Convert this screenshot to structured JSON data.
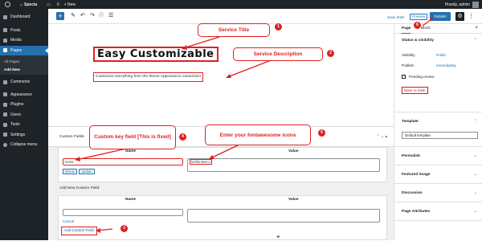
{
  "adminbar": {
    "site": "Specia",
    "comments_count": "0",
    "new_label": "+ New",
    "greeting": "Howdy, admin"
  },
  "sidebar": {
    "items_top": [
      {
        "label": "Dashboard",
        "icon": "dashboard-icon"
      },
      {
        "label": "Posts",
        "icon": "pin-icon"
      },
      {
        "label": "Media",
        "icon": "media-icon"
      },
      {
        "label": "Pages",
        "icon": "pages-icon"
      }
    ],
    "pages_sub": [
      "All Pages",
      "Add New"
    ],
    "items_bottom": [
      {
        "label": "Comments",
        "icon": "comment-icon"
      },
      {
        "label": "Appearance",
        "icon": "brush-icon"
      },
      {
        "label": "Plugins",
        "icon": "plugin-icon"
      },
      {
        "label": "Users",
        "icon": "user-icon"
      },
      {
        "label": "Tools",
        "icon": "wrench-icon"
      },
      {
        "label": "Settings",
        "icon": "settings-icon"
      },
      {
        "label": "Collapse menu",
        "icon": "collapse-icon"
      }
    ]
  },
  "toolbar": {
    "save_draft": "Save draft",
    "preview": "Preview",
    "publish": "Publish"
  },
  "editor": {
    "title": "Easy Customizable",
    "description": "Customize everything from the theme Appearance customizer"
  },
  "custom_fields": {
    "heading": "Custom Fields",
    "col_name": "Name",
    "col_value": "Value",
    "key": "icons",
    "value": "fa-file-text-o",
    "delete_label": "Delete",
    "update_label": "Update",
    "add_new_heading": "Add New Custom Field:",
    "cancel_label": "Cancel",
    "add_button": "Add Custom Field"
  },
  "callouts": [
    {
      "num": "1",
      "text": "Service Title"
    },
    {
      "num": "2",
      "text": "Service Description"
    },
    {
      "num": "3",
      "text": ""
    },
    {
      "num": "4",
      "text": "Custom key field [This is fixed]"
    },
    {
      "num": "5",
      "text": "Enter your fontawesome icons"
    },
    {
      "num": "6",
      "text": ""
    }
  ],
  "panel": {
    "tab_page": "Page",
    "tab_block": "Block",
    "status_heading": "Status & visibility",
    "visibility_label": "Visibility",
    "visibility_value": "Public",
    "publish_label": "Publish",
    "publish_value": "Immediately",
    "pending_label": "Pending review",
    "trash_label": "Move to trash",
    "template_heading": "Template",
    "template_value": "Default template",
    "permalink": "Permalink",
    "featured_image": "Featured image",
    "discussion": "Discussion",
    "page_attributes": "Page Attributes"
  },
  "colors": {
    "accent": "#2271b1",
    "annotation": "#e02020",
    "sidebar": "#1d2327"
  }
}
